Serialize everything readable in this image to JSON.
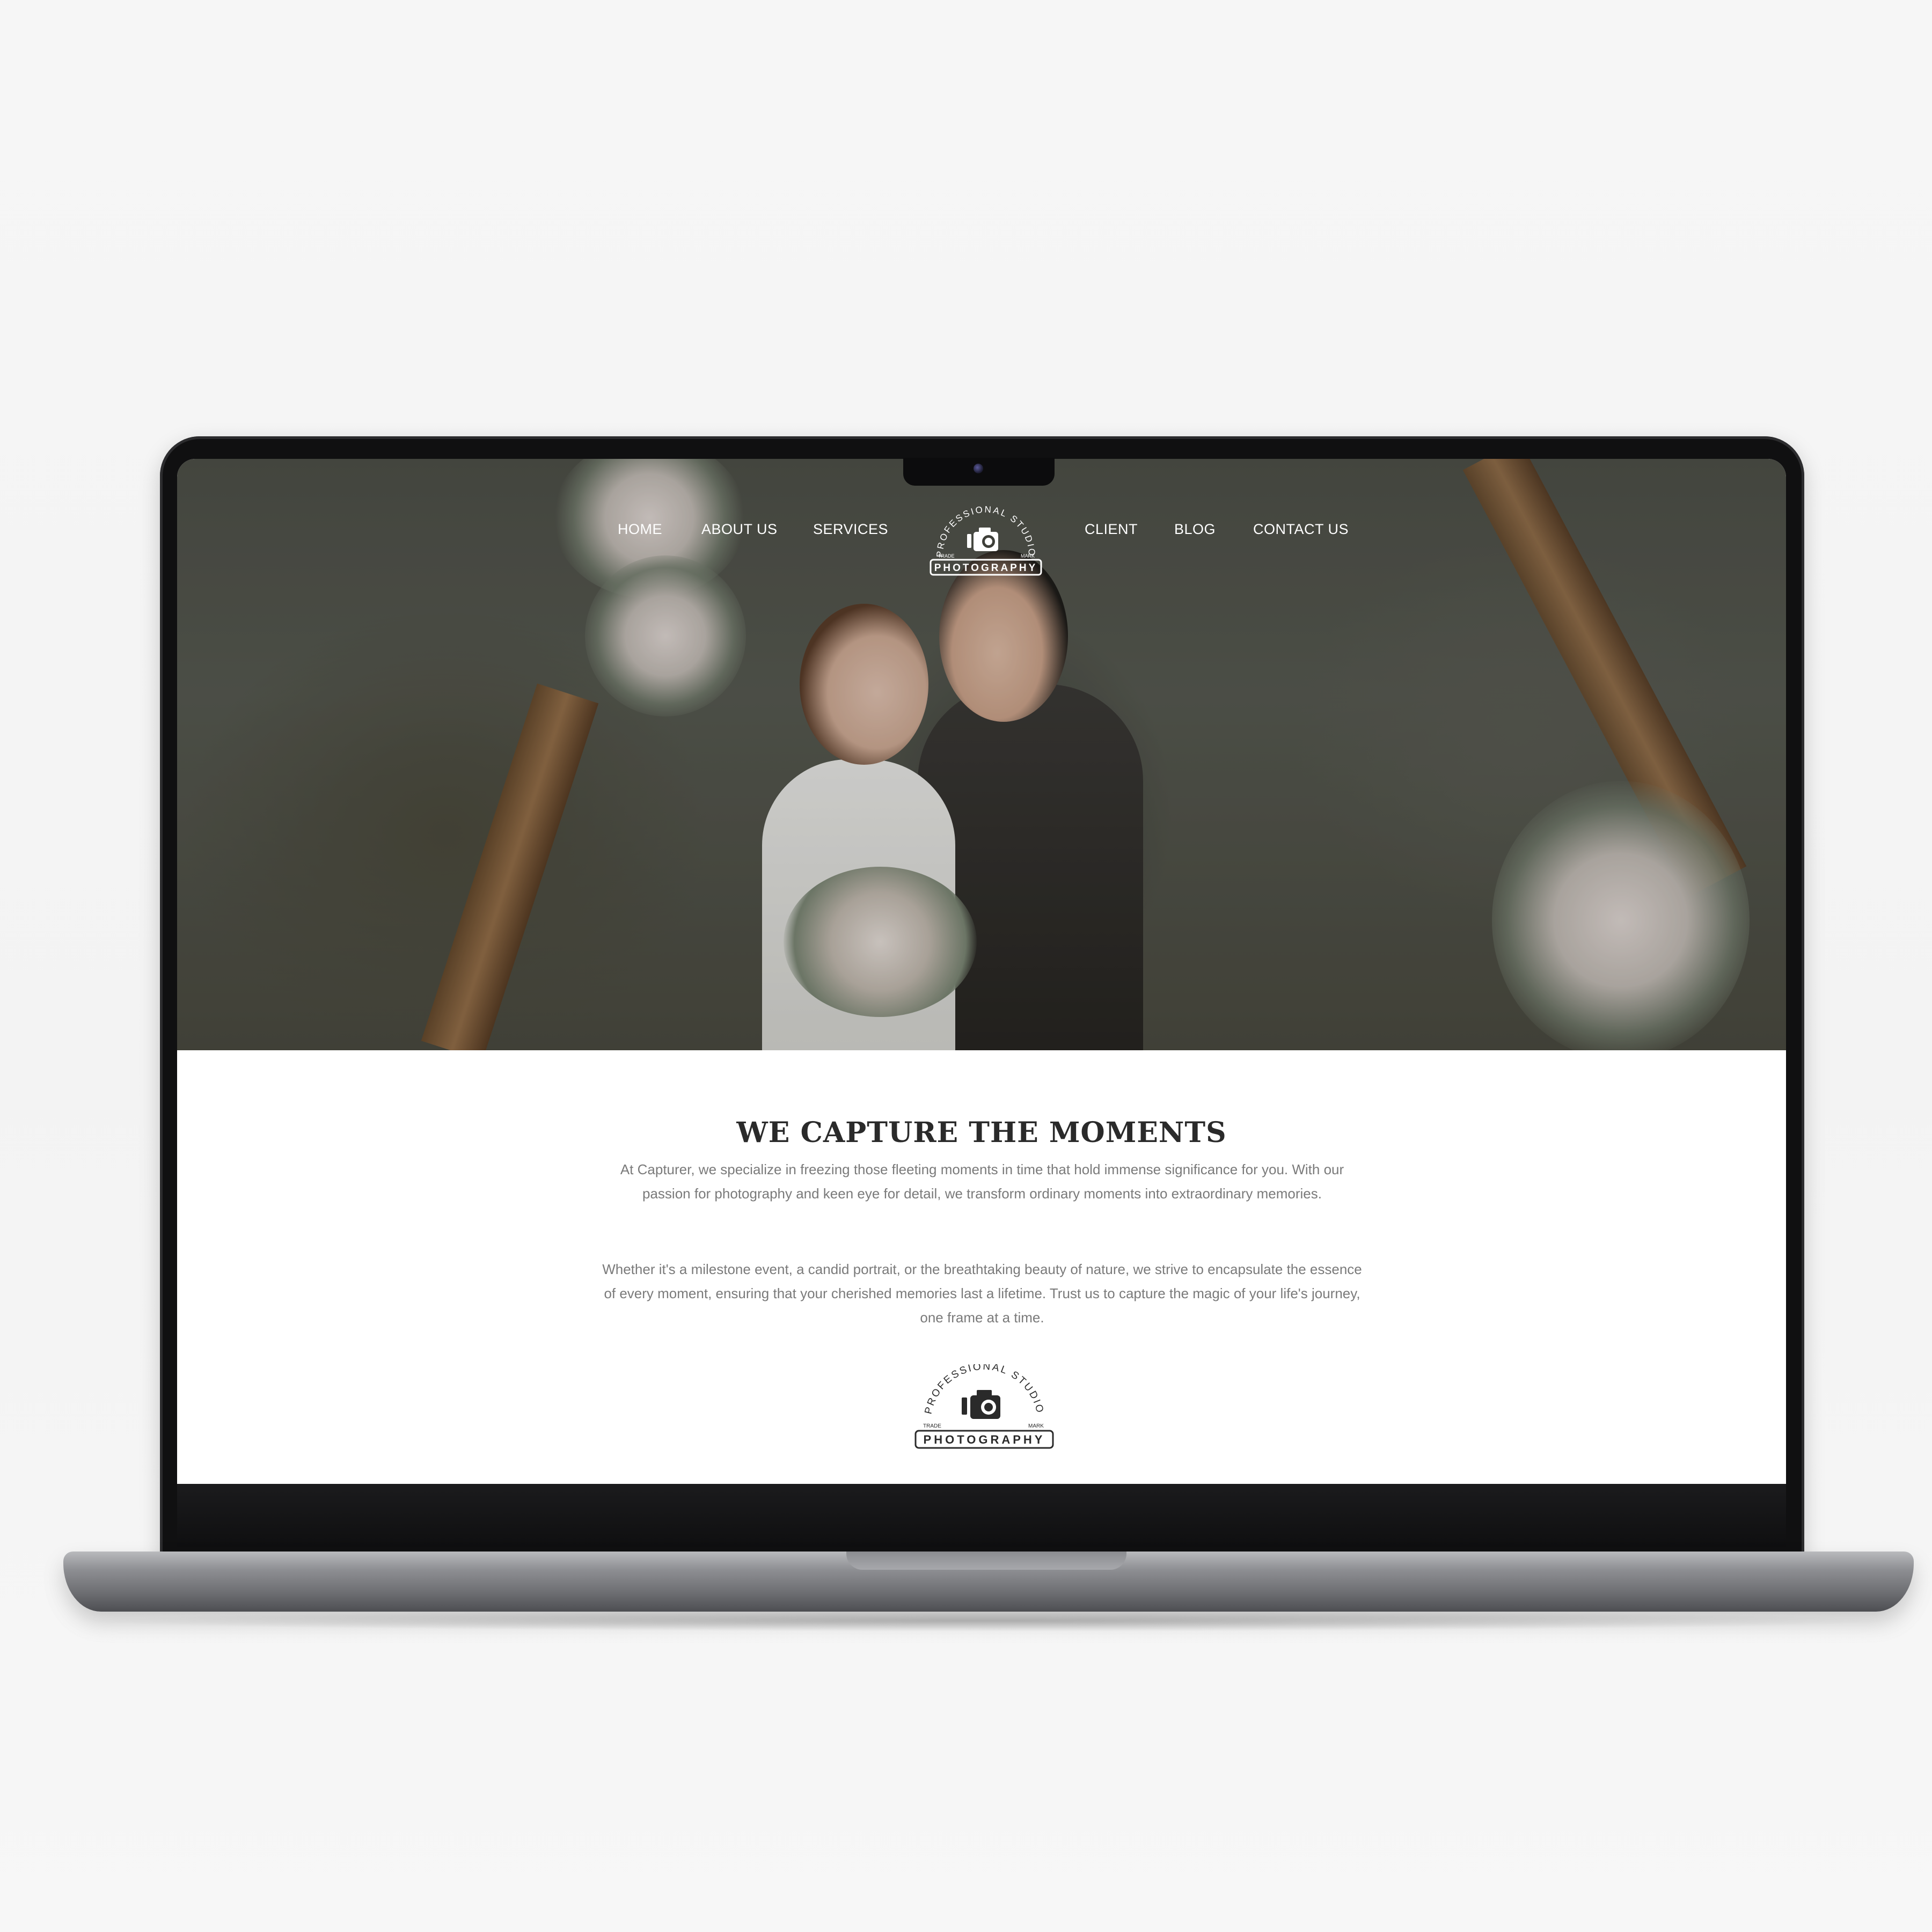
{
  "nav": {
    "items": [
      {
        "label": "HOME"
      },
      {
        "label": "ABOUT US"
      },
      {
        "label": "SERVICES"
      },
      {
        "label": "CLIENT"
      },
      {
        "label": "BLOG"
      },
      {
        "label": "CONTACT US"
      }
    ]
  },
  "logo": {
    "arc_text": "PROFESSIONAL STUDIO",
    "word": "PHOTOGRAPHY",
    "left_mark": "TRADE",
    "right_mark": "MARK"
  },
  "intro": {
    "heading": "WE CAPTURE THE MOMENTS",
    "paragraph_1": "At Capturer, we specialize in freezing those fleeting moments in time that hold immense significance for you. With our passion for photography and keen eye for detail, we transform ordinary moments into extraordinary memories.",
    "paragraph_2": "Whether it's a milestone event, a candid portrait, or the breathtaking beauty of nature, we strive to encapsulate the essence of every moment, ensuring that your cherished memories last a lifetime. Trust us to capture the magic of your life's journey, one frame at a time."
  },
  "colors": {
    "nav_text": "#ffffff",
    "heading": "#2a2a2a",
    "body_text": "#7a7a7a",
    "laptop_frame": "#101011"
  }
}
